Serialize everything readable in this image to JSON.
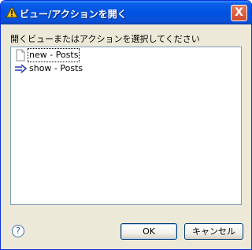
{
  "window": {
    "title": "ビュー/アクションを開く",
    "close_label": "X"
  },
  "dialog": {
    "prompt": "開くビューまたはアクションを選択してください",
    "items": [
      {
        "label": "new - Posts",
        "icon": "file-icon",
        "selected": true
      },
      {
        "label": "show - Posts",
        "icon": "action-arrow-icon",
        "selected": false
      }
    ]
  },
  "buttons": {
    "help_label": "?",
    "ok_label": "OK",
    "cancel_label": "キャンセル"
  }
}
